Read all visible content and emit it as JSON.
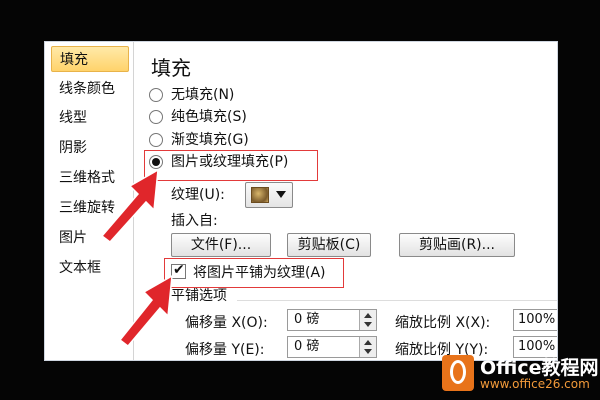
{
  "sidebar": {
    "items": [
      {
        "label": "填充",
        "selected": true
      },
      {
        "label": "线条颜色"
      },
      {
        "label": "线型"
      },
      {
        "label": "阴影"
      },
      {
        "label": "三维格式"
      },
      {
        "label": "三维旋转"
      },
      {
        "label": "图片"
      },
      {
        "label": "文本框"
      }
    ]
  },
  "fill": {
    "title": "填充",
    "options": [
      {
        "label": "无填充(N)",
        "checked": false
      },
      {
        "label": "纯色填充(S)",
        "checked": false
      },
      {
        "label": "渐变填充(G)",
        "checked": false
      },
      {
        "label": "图片或纹理填充(P)",
        "checked": true
      }
    ],
    "texture_label": "纹理(U):",
    "insert_from_label": "插入自:",
    "buttons": {
      "file": "文件(F)...",
      "clipboard": "剪贴板(C)",
      "clipart": "剪贴画(R)..."
    },
    "tile_checkbox": {
      "label": "将图片平铺为纹理(A)",
      "checked": true
    },
    "tiling_options_label": "平铺选项",
    "offset_x": {
      "label": "偏移量 X(O):",
      "value": "0 磅"
    },
    "offset_y": {
      "label": "偏移量 Y(E):",
      "value": "0 磅"
    },
    "scale_x": {
      "label": "缩放比例 X(X):",
      "value": "100%"
    },
    "scale_y": {
      "label": "缩放比例 Y(Y):",
      "value": "100%"
    }
  },
  "watermark": {
    "brand": "Office教程网",
    "url": "www.office26.com"
  },
  "colors": {
    "highlight": "#e23a3a",
    "selected_tab": "#ffd36b",
    "watermark_orange": "#e8731a"
  },
  "icons": [
    "texture-thumbnail-icon",
    "dropdown-arrow-icon",
    "checkmark-icon",
    "spin-up-icon",
    "spin-down-icon",
    "red-arrow-icon",
    "office-logo-icon"
  ]
}
